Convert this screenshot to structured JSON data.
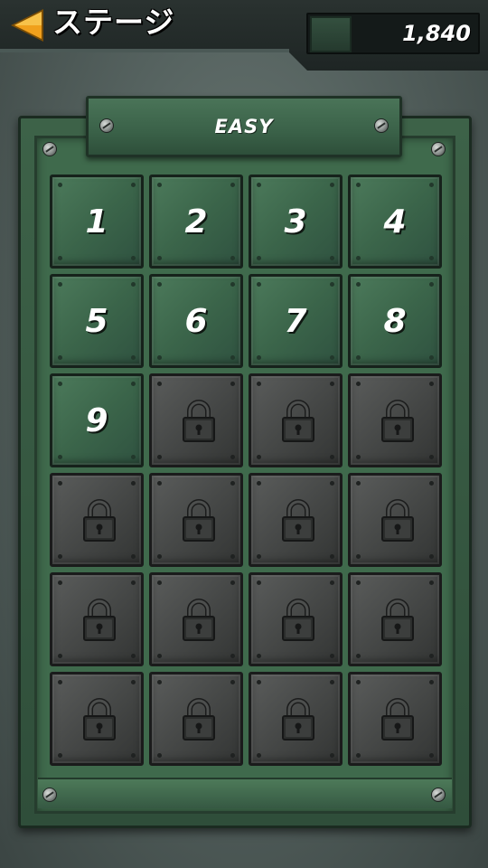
{
  "header": {
    "title": "ステージ",
    "back_icon": "back-arrow-icon",
    "currency_value": "1,840"
  },
  "board": {
    "difficulty_label": "EASY"
  },
  "stages": [
    {
      "label": "1",
      "locked": false
    },
    {
      "label": "2",
      "locked": false
    },
    {
      "label": "3",
      "locked": false
    },
    {
      "label": "4",
      "locked": false
    },
    {
      "label": "5",
      "locked": false
    },
    {
      "label": "6",
      "locked": false
    },
    {
      "label": "7",
      "locked": false
    },
    {
      "label": "8",
      "locked": false
    },
    {
      "label": "9",
      "locked": false
    },
    {
      "label": "",
      "locked": true
    },
    {
      "label": "",
      "locked": true
    },
    {
      "label": "",
      "locked": true
    },
    {
      "label": "",
      "locked": true
    },
    {
      "label": "",
      "locked": true
    },
    {
      "label": "",
      "locked": true
    },
    {
      "label": "",
      "locked": true
    },
    {
      "label": "",
      "locked": true
    },
    {
      "label": "",
      "locked": true
    },
    {
      "label": "",
      "locked": true
    },
    {
      "label": "",
      "locked": true
    },
    {
      "label": "",
      "locked": true
    },
    {
      "label": "",
      "locked": true
    },
    {
      "label": "",
      "locked": true
    },
    {
      "label": "",
      "locked": true
    }
  ],
  "colors": {
    "unlocked_tile": "#3b654a",
    "locked_tile": "#464847",
    "back_arrow": "#f0a01c"
  }
}
